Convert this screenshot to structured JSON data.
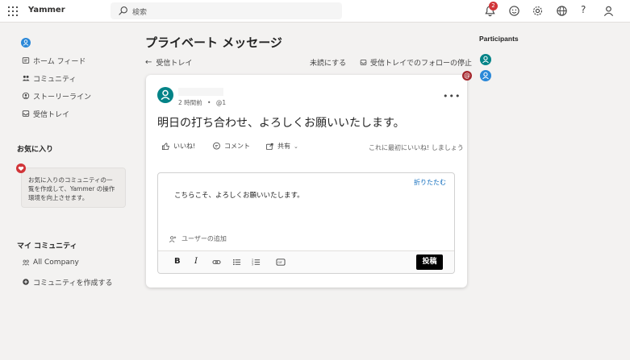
{
  "app": {
    "title": "Yammer"
  },
  "search": {
    "placeholder": "検索"
  },
  "notifications": {
    "count": "2"
  },
  "nav": {
    "items": [
      {
        "label": "ホーム フィード",
        "icon": "home-feed-icon"
      },
      {
        "label": "コミュニティ",
        "icon": "community-icon"
      },
      {
        "label": "ストーリーライン",
        "icon": "storyline-icon"
      },
      {
        "label": "受信トレイ",
        "icon": "inbox-icon"
      }
    ],
    "favorites_title": "お気に入り",
    "favorites_hint": "お気に入りのコミュニティの一覧を作成して、Yammer の操作環境を向上させます。",
    "my_communities_title": "マイ コミュニティ",
    "communities": [
      {
        "label": "All Company"
      }
    ],
    "create_community": "コミュニティを作成する"
  },
  "page": {
    "title": "プライベート メッセージ",
    "back_label": "受信トレイ",
    "mark_unread": "未読にする",
    "stop_following": "受信トレイでのフォローの停止"
  },
  "post": {
    "time": "2 時間前",
    "mention_badge": "@1",
    "message": "明日の打ち合わせ、よろしくお願いいたします。",
    "like_label": "いいね!",
    "comment_label": "コメント",
    "share_label": "共有",
    "first_like": "これに最初にいいね! しましょう"
  },
  "reply": {
    "collapse_label": "折りたたむ",
    "text": "こちらこそ、よろしくお願いいたします。",
    "add_user_label": "ユーザーの追加",
    "post_label": "投稿",
    "toolbar": {
      "bold": "B",
      "italic": "I"
    }
  },
  "participants": {
    "title": "Participants",
    "colors": [
      "#038387",
      "#2b88d8"
    ]
  },
  "colors": {
    "accent": "#0f6cbd",
    "badge": "#d13438",
    "mention": "#a4262c"
  }
}
